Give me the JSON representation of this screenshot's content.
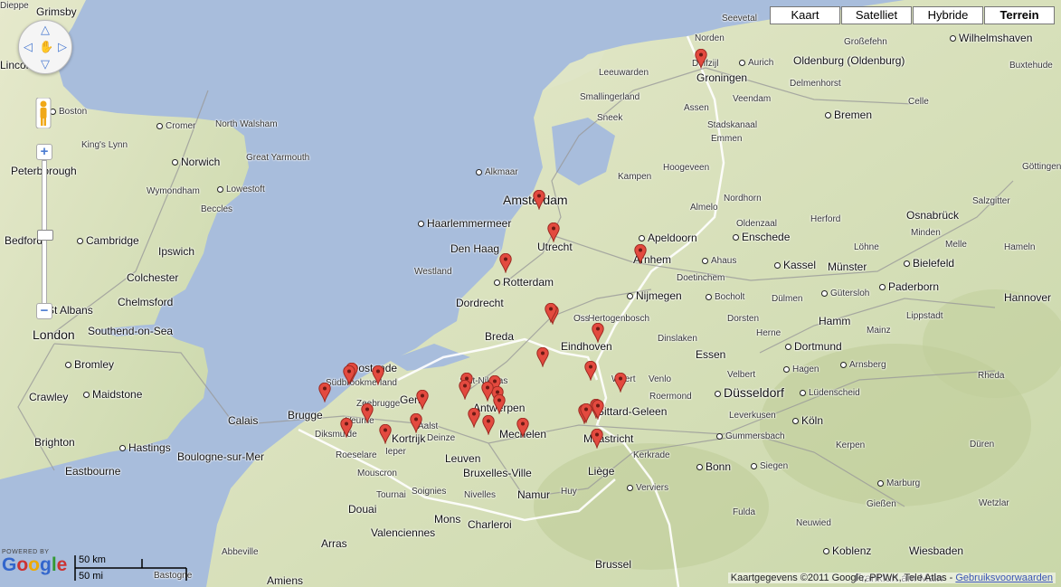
{
  "map_type_buttons": [
    {
      "label": "Kaart",
      "active": false
    },
    {
      "label": "Satelliet",
      "active": false
    },
    {
      "label": "Hybride",
      "active": false
    },
    {
      "label": "Terrein",
      "active": true
    }
  ],
  "controls": {
    "pan_icon": "pan-control-icon",
    "zoom_in": "+",
    "zoom_out": "−",
    "pegman_icon": "pegman-icon"
  },
  "branding": {
    "powered_by": "POWERED BY",
    "logo": "Google"
  },
  "scale": {
    "km": "50 km",
    "mi": "50 mi"
  },
  "attribution": {
    "text": "Kaartgegevens ©2011 Google, PPWK, Tele Atlas - ",
    "link": "Gebruiksvoorwaarden"
  },
  "colors": {
    "sea": "#a8bddc",
    "land": "#dde4c4",
    "marker": "#e34a3f"
  },
  "places": [
    {
      "name": "Grimsby",
      "size": "n",
      "dot": false
    },
    {
      "name": "Boston",
      "size": "s",
      "dot": true
    },
    {
      "name": "Lincoln",
      "size": "n",
      "dot": false
    },
    {
      "name": "Cromer",
      "size": "s",
      "dot": true
    },
    {
      "name": "North Walsham",
      "size": "s",
      "dot": false
    },
    {
      "name": "King's Lynn",
      "size": "s",
      "dot": false
    },
    {
      "name": "Norwich",
      "size": "n",
      "dot": true
    },
    {
      "name": "Great Yarmouth",
      "size": "s",
      "dot": false
    },
    {
      "name": "Wymondham",
      "size": "s",
      "dot": false
    },
    {
      "name": "Lowestoft",
      "size": "s",
      "dot": true
    },
    {
      "name": "Beccles",
      "size": "s",
      "dot": false
    },
    {
      "name": "Peterborough",
      "size": "n",
      "dot": false
    },
    {
      "name": "Bedford",
      "size": "n",
      "dot": false
    },
    {
      "name": "Cambridge",
      "size": "n",
      "dot": true
    },
    {
      "name": "Ipswich",
      "size": "n",
      "dot": false
    },
    {
      "name": "Colchester",
      "size": "n",
      "dot": false
    },
    {
      "name": "Chelmsford",
      "size": "n",
      "dot": false
    },
    {
      "name": "St Albans",
      "size": "n",
      "dot": false
    },
    {
      "name": "Southend-on-Sea",
      "size": "n",
      "dot": false
    },
    {
      "name": "London",
      "size": "l",
      "dot": false
    },
    {
      "name": "Bromley",
      "size": "n",
      "dot": true
    },
    {
      "name": "Crawley",
      "size": "n",
      "dot": false
    },
    {
      "name": "Maidstone",
      "size": "n",
      "dot": true
    },
    {
      "name": "Brighton",
      "size": "n",
      "dot": false
    },
    {
      "name": "Hastings",
      "size": "n",
      "dot": true
    },
    {
      "name": "Eastbourne",
      "size": "n",
      "dot": false
    },
    {
      "name": "Calais",
      "size": "n",
      "dot": false
    },
    {
      "name": "Boulogne-sur-Mer",
      "size": "n",
      "dot": false
    },
    {
      "name": "Abbeville",
      "size": "s",
      "dot": false
    },
    {
      "name": "Amiens",
      "size": "n",
      "dot": false
    },
    {
      "name": "Arras",
      "size": "n",
      "dot": false
    },
    {
      "name": "Douai",
      "size": "n",
      "dot": false
    },
    {
      "name": "Valenciennes",
      "size": "n",
      "dot": false
    },
    {
      "name": "Mons",
      "size": "n",
      "dot": false
    },
    {
      "name": "Charleroi",
      "size": "n",
      "dot": false
    },
    {
      "name": "Namur",
      "size": "n",
      "dot": false
    },
    {
      "name": "Tournai",
      "size": "s",
      "dot": false
    },
    {
      "name": "Mouscron",
      "size": "s",
      "dot": false
    },
    {
      "name": "Soignies",
      "size": "s",
      "dot": false
    },
    {
      "name": "Nivelles",
      "size": "s",
      "dot": false
    },
    {
      "name": "Huy",
      "size": "s",
      "dot": false
    },
    {
      "name": "Verviers",
      "size": "s",
      "dot": true
    },
    {
      "name": "Liège",
      "size": "n",
      "dot": false
    },
    {
      "name": "Maastricht",
      "size": "n",
      "dot": false
    },
    {
      "name": "Kerkrade",
      "size": "s",
      "dot": false
    },
    {
      "name": "Sittard-Geleen",
      "size": "n",
      "dot": false
    },
    {
      "name": "Roermond",
      "size": "s",
      "dot": false
    },
    {
      "name": "Weert",
      "size": "s",
      "dot": false
    },
    {
      "name": "Venlo",
      "size": "s",
      "dot": false
    },
    {
      "name": "Eindhoven",
      "size": "n",
      "dot": false
    },
    {
      "name": "'s-Hertogenbosch",
      "size": "s",
      "dot": false
    },
    {
      "name": "Breda",
      "size": "n",
      "dot": false
    },
    {
      "name": "Dordrecht",
      "size": "n",
      "dot": false
    },
    {
      "name": "Rotterdam",
      "size": "n",
      "dot": true
    },
    {
      "name": "Westland",
      "size": "s",
      "dot": false
    },
    {
      "name": "Den Haag",
      "size": "n",
      "dot": false
    },
    {
      "name": "Haarlemmermeer",
      "size": "n",
      "dot": true
    },
    {
      "name": "Amsterdam",
      "size": "l",
      "dot": false
    },
    {
      "name": "Alkmaar",
      "size": "s",
      "dot": true
    },
    {
      "name": "Utrecht",
      "size": "n",
      "dot": false
    },
    {
      "name": "Apeldoorn",
      "size": "n",
      "dot": true
    },
    {
      "name": "Arnhem",
      "size": "n",
      "dot": false
    },
    {
      "name": "Nijmegen",
      "size": "n",
      "dot": true
    },
    {
      "name": "Oss",
      "size": "s",
      "dot": false
    },
    {
      "name": "Leeuwarden",
      "size": "s",
      "dot": false
    },
    {
      "name": "Smallingerland",
      "size": "s",
      "dot": false
    },
    {
      "name": "Sneek",
      "size": "s",
      "dot": false
    },
    {
      "name": "Groningen",
      "size": "n",
      "dot": false
    },
    {
      "name": "Delfzijl",
      "size": "s",
      "dot": false
    },
    {
      "name": "Assen",
      "size": "s",
      "dot": false
    },
    {
      "name": "Emmen",
      "size": "s",
      "dot": false
    },
    {
      "name": "Stadskanaal",
      "size": "s",
      "dot": false
    },
    {
      "name": "Veendam",
      "size": "s",
      "dot": false
    },
    {
      "name": "Hoogeveen",
      "size": "s",
      "dot": false
    },
    {
      "name": "Kampen",
      "size": "s",
      "dot": false
    },
    {
      "name": "Almelo",
      "size": "s",
      "dot": false
    },
    {
      "name": "Oldenzaal",
      "size": "s",
      "dot": false
    },
    {
      "name": "Enschede",
      "size": "n",
      "dot": true
    },
    {
      "name": "Nordhorn",
      "size": "s",
      "dot": false
    },
    {
      "name": "Ahaus",
      "size": "s",
      "dot": true
    },
    {
      "name": "Doetinchem",
      "size": "s",
      "dot": false
    },
    {
      "name": "Bocholt",
      "size": "s",
      "dot": true
    },
    {
      "name": "Dülmen",
      "size": "s",
      "dot": false
    },
    {
      "name": "Dorsten",
      "size": "s",
      "dot": false
    },
    {
      "name": "Herne",
      "size": "s",
      "dot": false
    },
    {
      "name": "Dinslaken",
      "size": "s",
      "dot": false
    },
    {
      "name": "Essen",
      "size": "n",
      "dot": false
    },
    {
      "name": "Dortmund",
      "size": "n",
      "dot": true
    },
    {
      "name": "Hamm",
      "size": "n",
      "dot": false
    },
    {
      "name": "Velbert",
      "size": "s",
      "dot": false
    },
    {
      "name": "Hagen",
      "size": "s",
      "dot": true
    },
    {
      "name": "Arnsberg",
      "size": "s",
      "dot": true
    },
    {
      "name": "Düsseldorf",
      "size": "l",
      "dot": true
    },
    {
      "name": "Lüdenscheid",
      "size": "s",
      "dot": true
    },
    {
      "name": "Leverkusen",
      "size": "s",
      "dot": false
    },
    {
      "name": "Köln",
      "size": "n",
      "dot": true
    },
    {
      "name": "Gummersbach",
      "size": "s",
      "dot": true
    },
    {
      "name": "Kerpen",
      "size": "s",
      "dot": false
    },
    {
      "name": "Siegen",
      "size": "s",
      "dot": true
    },
    {
      "name": "Bonn",
      "size": "n",
      "dot": true
    },
    {
      "name": "Düren",
      "size": "s",
      "dot": false
    },
    {
      "name": "Marburg",
      "size": "s",
      "dot": true
    },
    {
      "name": "Gießen",
      "size": "s",
      "dot": false
    },
    {
      "name": "Wetzlar",
      "size": "s",
      "dot": false
    },
    {
      "name": "Fulda",
      "size": "s",
      "dot": false
    },
    {
      "name": "Neuwied",
      "size": "s",
      "dot": false
    },
    {
      "name": "Koblenz",
      "size": "n",
      "dot": true
    },
    {
      "name": "Wiesbaden",
      "size": "n",
      "dot": false
    },
    {
      "name": "Frankfurt am Main",
      "size": "n",
      "dot": false
    },
    {
      "name": "Mainz",
      "size": "s",
      "dot": false
    },
    {
      "name": "Lippstadt",
      "size": "s",
      "dot": false
    },
    {
      "name": "Paderborn",
      "size": "n",
      "dot": true
    },
    {
      "name": "Gütersloh",
      "size": "s",
      "dot": true
    },
    {
      "name": "Rheda",
      "size": "s",
      "dot": false
    },
    {
      "name": "Kassel",
      "size": "n",
      "dot": true
    },
    {
      "name": "Münster",
      "size": "n",
      "dot": false
    },
    {
      "name": "Bielefeld",
      "size": "n",
      "dot": true
    },
    {
      "name": "Herford",
      "size": "s",
      "dot": false
    },
    {
      "name": "Osnabrück",
      "size": "n",
      "dot": false
    },
    {
      "name": "Minden",
      "size": "s",
      "dot": false
    },
    {
      "name": "Löhne",
      "size": "s",
      "dot": false
    },
    {
      "name": "Melle",
      "size": "s",
      "dot": false
    },
    {
      "name": "Hameln",
      "size": "s",
      "dot": false
    },
    {
      "name": "Salzgitter",
      "size": "s",
      "dot": false
    },
    {
      "name": "Hannover",
      "size": "n",
      "dot": false
    },
    {
      "name": "Göttingen",
      "size": "s",
      "dot": false
    },
    {
      "name": "Celle",
      "size": "s",
      "dot": false
    },
    {
      "name": "Bremen",
      "size": "n",
      "dot": true
    },
    {
      "name": "Delmenhorst",
      "size": "s",
      "dot": false
    },
    {
      "name": "Oldenburg (Oldenburg)",
      "size": "n",
      "dot": false
    },
    {
      "name": "Aurich",
      "size": "s",
      "dot": true
    },
    {
      "name": "Großefehn",
      "size": "s",
      "dot": false
    },
    {
      "name": "Emden",
      "size": "s",
      "dot": false
    },
    {
      "name": "Wilhelmshaven",
      "size": "n",
      "dot": true
    },
    {
      "name": "Buxtehude",
      "size": "s",
      "dot": false
    },
    {
      "name": "Seevetal",
      "size": "s",
      "dot": false
    },
    {
      "name": "Norden",
      "size": "s",
      "dot": false
    },
    {
      "name": "Südbrookmerland",
      "size": "s",
      "dot": false
    },
    {
      "name": "Oostende",
      "size": "n",
      "dot": false
    },
    {
      "name": "Zeebrugge",
      "size": "s",
      "dot": false
    },
    {
      "name": "Brugge",
      "size": "n",
      "dot": false
    },
    {
      "name": "Veurne",
      "size": "s",
      "dot": false
    },
    {
      "name": "Diksmuide",
      "size": "s",
      "dot": false
    },
    {
      "name": "Roeselare",
      "size": "s",
      "dot": false
    },
    {
      "name": "Ieper",
      "size": "s",
      "dot": false
    },
    {
      "name": "Kortrijk",
      "size": "n",
      "dot": false
    },
    {
      "name": "Deinze",
      "size": "s",
      "dot": false
    },
    {
      "name": "Aalst",
      "size": "s",
      "dot": false
    },
    {
      "name": "Gent",
      "size": "n",
      "dot": false
    },
    {
      "name": "Sint-Niklaas",
      "size": "s",
      "dot": false
    },
    {
      "name": "Antwerpen",
      "size": "n",
      "dot": false
    },
    {
      "name": "Mechelen",
      "size": "n",
      "dot": false
    },
    {
      "name": "Leuven",
      "size": "n",
      "dot": false
    },
    {
      "name": "Bruxelles-Ville",
      "size": "n",
      "dot": false
    },
    {
      "name": "Brussel",
      "size": "n",
      "dot": false
    },
    {
      "name": "Bastogne",
      "size": "s",
      "dot": false
    },
    {
      "name": "Dieppe",
      "size": "s",
      "dot": false
    }
  ],
  "markers_count": 34
}
